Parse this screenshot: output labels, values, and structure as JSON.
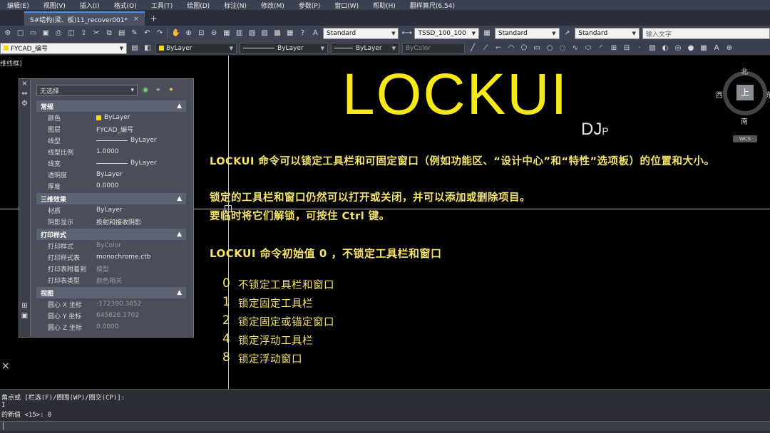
{
  "menu": [
    "编辑(E)",
    "视图(V)",
    "插入(I)",
    "格式(O)",
    "工具(T)",
    "绘图(D)",
    "标注(N)",
    "修改(M)",
    "参数(P)",
    "窗口(W)",
    "帮助(H)",
    "翻样算尺(6.54)"
  ],
  "tab": {
    "label": "S#结构(梁、板)11_recover001*",
    "close": "×",
    "add": "+"
  },
  "toolbar1": {
    "text_style": "Standard",
    "dim_style": "TSSD_100_100",
    "table_style": "Standard",
    "mleader_style": "Standard",
    "search_placeholder": "输入文字"
  },
  "toolbar2": {
    "layer": "FYCAD_编号",
    "color": "ByLayer",
    "linetype": "ByLayer",
    "lineweight": "ByLayer",
    "plotstyle": "ByColor"
  },
  "view_label": "维线框]",
  "palette": {
    "selection": "无选择",
    "sections": [
      {
        "title": "常规",
        "rows": [
          {
            "k": "颜色",
            "v": "ByLayer",
            "swatch": true
          },
          {
            "k": "图层",
            "v": "FYCAD_编号"
          },
          {
            "k": "线型",
            "v": "ByLayer",
            "line": true
          },
          {
            "k": "线型比例",
            "v": "1.0000"
          },
          {
            "k": "线宽",
            "v": "ByLayer",
            "line": true
          },
          {
            "k": "透明度",
            "v": "ByLayer"
          },
          {
            "k": "厚度",
            "v": "0.0000"
          }
        ]
      },
      {
        "title": "三维效果",
        "rows": [
          {
            "k": "材质",
            "v": "ByLayer"
          },
          {
            "k": "阴影显示",
            "v": "投射和接收阴影"
          }
        ]
      },
      {
        "title": "打印样式",
        "rows": [
          {
            "k": "打印样式",
            "v": "ByColor",
            "dim": true
          },
          {
            "k": "打印样式表",
            "v": "monochrome.ctb"
          },
          {
            "k": "打印表附着到",
            "v": "模型",
            "dim": true
          },
          {
            "k": "打印表类型",
            "v": "颜色相关",
            "dim": true
          }
        ]
      },
      {
        "title": "视图",
        "rows": [
          {
            "k": "圆心 X 坐标",
            "v": "-172390.3652",
            "dim": true
          },
          {
            "k": "圆心 Y 坐标",
            "v": "645826.1702",
            "dim": true
          },
          {
            "k": "圆心 Z 坐标",
            "v": "0.0000",
            "dim": true
          }
        ]
      }
    ]
  },
  "drawing": {
    "title": "LOCKUI",
    "logo": "DJ",
    "logo_sub": "P",
    "line1": "LOCKUI 命令可以锁定工具栏和可固定窗口（例如功能区、“设计中心”和“特性”选项板）的位置和大小。",
    "line2": "锁定的工具栏和窗口仍然可以打开或关闭，并可以添加或删除项目。",
    "line3": "要临时将它们解锁，可按住 Ctrl 键。",
    "line4": "LOCKUI 命令初始值 0 ，不锁定工具栏和窗口",
    "options": [
      {
        "n": "0",
        "t": "不锁定工具栏和窗口"
      },
      {
        "n": "1",
        "t": "锁定固定工具栏"
      },
      {
        "n": "2",
        "t": "锁定固定或锚定窗口"
      },
      {
        "n": "4",
        "t": "锁定浮动工具栏"
      },
      {
        "n": "8",
        "t": "锁定浮动窗口"
      }
    ]
  },
  "viewcube": {
    "north": "北",
    "west": "西",
    "east": "东",
    "south": "南",
    "face": "上",
    "wcs": "WCS"
  },
  "command": {
    "line1": "角点或 [栏选(F)/圈围(WP)/圈交(CP)]:",
    "line2": "I",
    "line3": " 的新值 <15>: 0"
  }
}
